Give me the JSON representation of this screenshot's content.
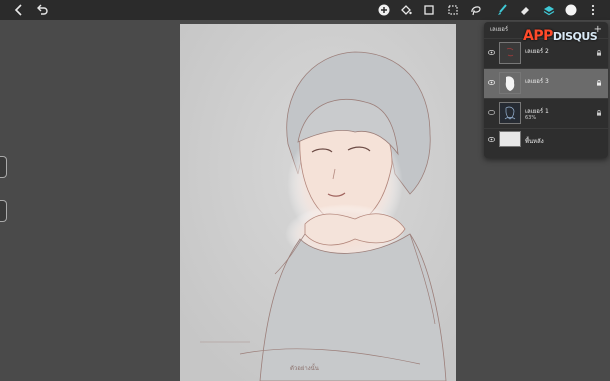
{
  "toolbar": {
    "left_icons": [
      "chevron-left-icon",
      "undo-icon"
    ],
    "right_icons": [
      "add-circle-icon",
      "paint-bucket-icon",
      "crop-icon",
      "selection-icon",
      "lasso-icon",
      "brush-icon",
      "eraser-icon",
      "layers-icon",
      "color-icon",
      "more-vertical-icon"
    ],
    "accent": "#3fc9d6"
  },
  "layers_panel": {
    "title": "เลเยอร์",
    "add_label": "+",
    "layers": [
      {
        "name": "เลเยอร์ 2",
        "sub": "",
        "active": false,
        "visible": true
      },
      {
        "name": "เลเยอร์ 3",
        "sub": "",
        "active": true,
        "visible": true
      },
      {
        "name": "เลเยอร์ 1",
        "sub": "63%",
        "active": false,
        "visible": false
      }
    ],
    "background": {
      "name": "พื้นหลัง",
      "visible": true
    }
  },
  "watermark": {
    "brand": "APP",
    "brand2": "DISQUS"
  },
  "canvas": {
    "signature": "ตัวอย่างนั้น"
  }
}
